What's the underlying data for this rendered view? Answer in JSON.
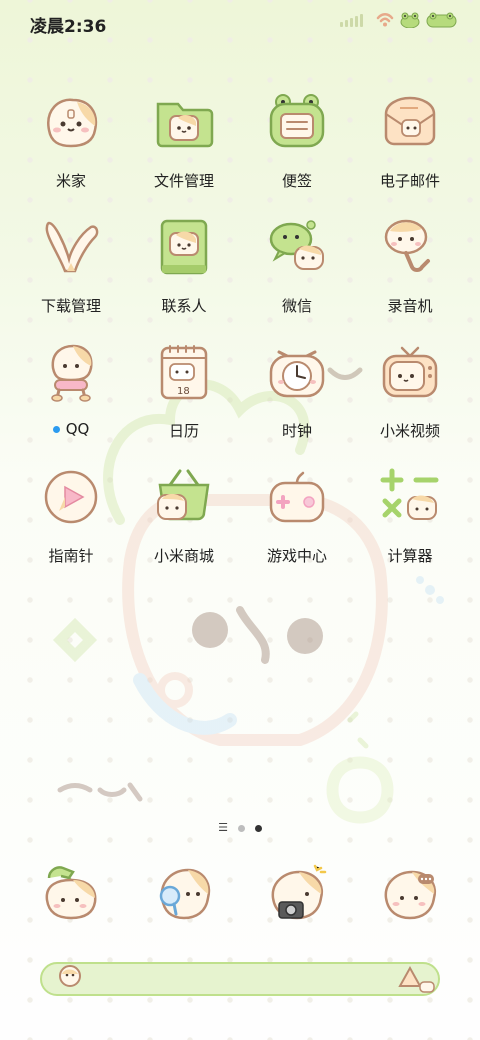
{
  "status_bar": {
    "time": "凌晨2:36"
  },
  "apps": [
    {
      "label": "米家",
      "icon": "mijia-icon"
    },
    {
      "label": "文件管理",
      "icon": "file-manager-icon"
    },
    {
      "label": "便签",
      "icon": "notes-icon"
    },
    {
      "label": "电子邮件",
      "icon": "email-icon"
    },
    {
      "label": "下载管理",
      "icon": "download-icon"
    },
    {
      "label": "联系人",
      "icon": "contacts-icon"
    },
    {
      "label": "微信",
      "icon": "wechat-icon"
    },
    {
      "label": "录音机",
      "icon": "recorder-icon"
    },
    {
      "label": "QQ",
      "icon": "qq-icon",
      "has_notification_dot": true
    },
    {
      "label": "日历",
      "icon": "calendar-icon",
      "day": "18"
    },
    {
      "label": "时钟",
      "icon": "clock-icon"
    },
    {
      "label": "小米视频",
      "icon": "video-icon"
    },
    {
      "label": "指南针",
      "icon": "compass-icon"
    },
    {
      "label": "小米商城",
      "icon": "mi-store-icon"
    },
    {
      "label": "游戏中心",
      "icon": "game-center-icon"
    },
    {
      "label": "计算器",
      "icon": "calculator-icon"
    }
  ],
  "page_indicator": {
    "pages": 2,
    "active": 2
  },
  "dock": [
    {
      "icon": "phone-icon"
    },
    {
      "icon": "browser-icon"
    },
    {
      "icon": "camera-icon"
    },
    {
      "icon": "messages-icon"
    }
  ],
  "search_bar": {
    "icon": "search-assistant-icon",
    "right_icon": "assistant-icon"
  },
  "colors": {
    "green": "#a6d36b",
    "cream": "#fff6e9",
    "outline": "#b98a6e",
    "notify": "#2b9bf0"
  }
}
